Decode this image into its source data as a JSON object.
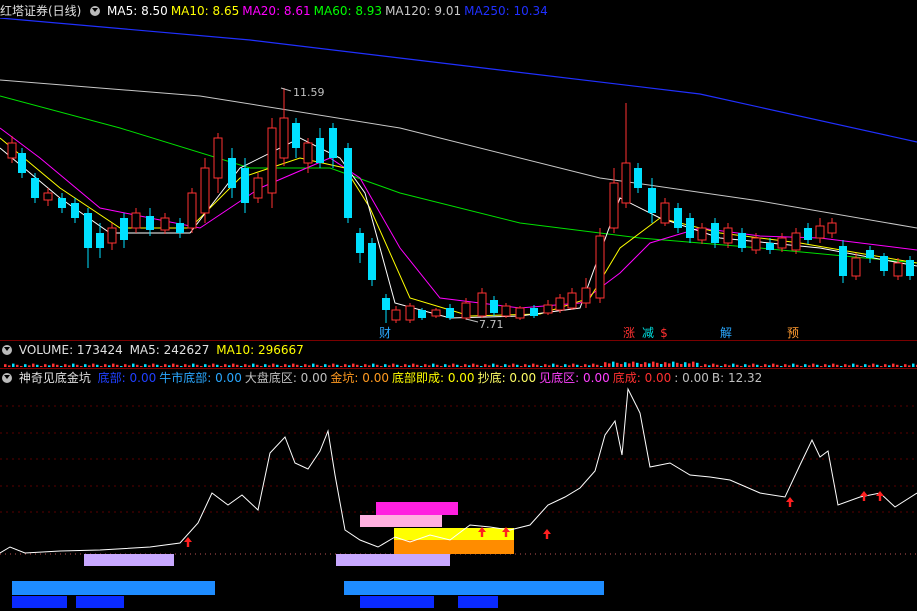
{
  "kline": {
    "title": "红塔证券(日线)",
    "ma": [
      {
        "label": "MA5: 8.50",
        "color": "#ffffff"
      },
      {
        "label": "MA10: 8.65",
        "color": "#ffff00"
      },
      {
        "label": "MA20: 8.61",
        "color": "#ff00ff"
      },
      {
        "label": "MA60: 8.93",
        "color": "#00ff00"
      },
      {
        "label": "MA120: 9.01",
        "color": "#c8c8c8"
      },
      {
        "label": "MA250: 10.34",
        "color": "#2030ff"
      }
    ],
    "high_mark": "11.59",
    "low_mark": "7.71",
    "events": [
      {
        "text": "财",
        "color": "#2aa8ff"
      },
      {
        "text": "涨",
        "color": "#ff3030"
      },
      {
        "text": "减",
        "color": "#00e0e0"
      },
      {
        "text": "$",
        "color": "#ff3030"
      },
      {
        "text": "解",
        "color": "#2aa8ff"
      },
      {
        "text": "预",
        "color": "#ff9a30"
      }
    ],
    "colors": {
      "up": "#ff3232",
      "down": "#00e0ff"
    }
  },
  "volume": {
    "label": "VOLUME: 173424",
    "ma5": "MA5: 242627",
    "ma10": "MA10: 296667"
  },
  "indicator": {
    "name": "神奇见底金坑",
    "items": [
      {
        "label": "底部: 0.00",
        "color": "#2040ff"
      },
      {
        "label": "牛市底部: 0.00",
        "color": "#2aa8ff"
      },
      {
        "label": "大盘底区: 0.00",
        "color": "#c0c0c0"
      },
      {
        "label": "金坑: 0.00",
        "color": "#ff9a20"
      },
      {
        "label": "底部即成: 0.00",
        "color": "#ffff00"
      },
      {
        "label": "抄底: 0.00",
        "color": "#ffff66"
      },
      {
        "label": "见底区: 0.00",
        "color": "#ff40ff"
      },
      {
        "label": "底成: 0.00",
        "color": "#ff3030"
      },
      {
        "label": ": 0.00",
        "color": "#c0c0c0"
      },
      {
        "label": "B: 12.32",
        "color": "#c0c0c0"
      }
    ]
  }
}
